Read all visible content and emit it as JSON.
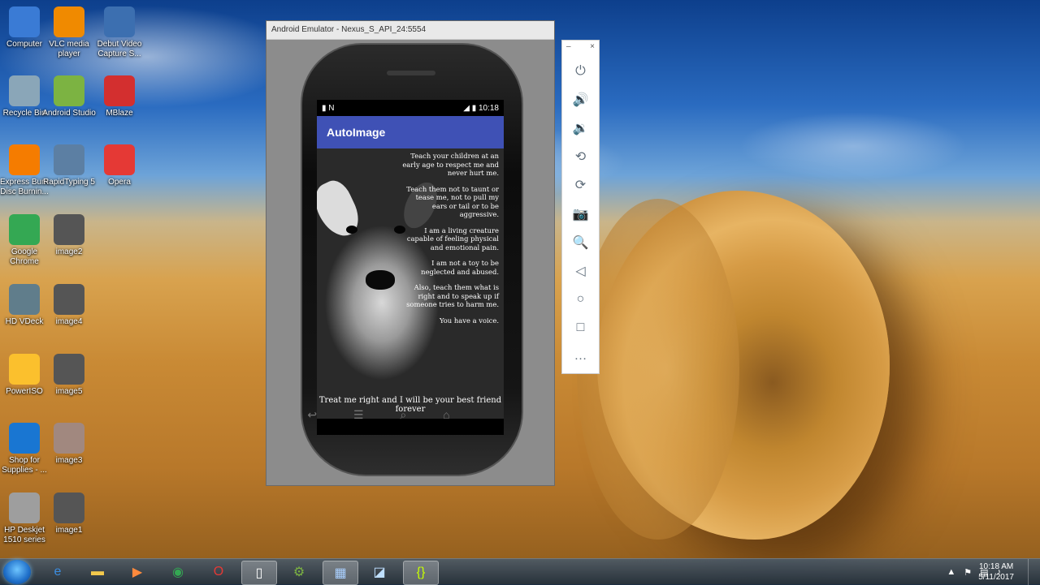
{
  "desktop": {
    "icons": [
      {
        "label": "Computer",
        "icon": "computer-icon",
        "color": "#3a7bd5"
      },
      {
        "label": "VLC media player",
        "icon": "vlc-icon",
        "color": "#f08a00"
      },
      {
        "label": "Debut Video Capture S...",
        "icon": "video-capture-icon",
        "color": "#3c6fb0"
      },
      {
        "label": "Recycle Bin",
        "icon": "recycle-bin-icon",
        "color": "#8aa6b8"
      },
      {
        "label": "Android Studio",
        "icon": "android-studio-icon",
        "color": "#7cb342"
      },
      {
        "label": "MBlaze",
        "icon": "mblaze-icon",
        "color": "#d32f2f"
      },
      {
        "label": "Express Burn Disc Burnin...",
        "icon": "express-burn-icon",
        "color": "#f57c00"
      },
      {
        "label": "RapidTyping 5",
        "icon": "rapidtyping-icon",
        "color": "#5c7fa3"
      },
      {
        "label": "Opera",
        "icon": "opera-icon",
        "color": "#e53935"
      },
      {
        "label": "Google Chrome",
        "icon": "chrome-icon",
        "color": "#34a853"
      },
      {
        "label": "image2",
        "icon": "image-thumbnail-icon",
        "color": "#555555"
      },
      {
        "label": "HD VDeck",
        "icon": "hd-vdeck-icon",
        "color": "#607d8b"
      },
      {
        "label": "image4",
        "icon": "image-thumbnail-icon",
        "color": "#555555"
      },
      {
        "label": "PowerISO",
        "icon": "poweriso-icon",
        "color": "#fbc02d"
      },
      {
        "label": "image5",
        "icon": "image-thumbnail-icon",
        "color": "#555555"
      },
      {
        "label": "Shop for Supplies - ...",
        "icon": "shop-supplies-icon",
        "color": "#1976d2"
      },
      {
        "label": "image3",
        "icon": "image-thumbnail-icon",
        "color": "#a1887f"
      },
      {
        "label": "HP Deskjet 1510 series",
        "icon": "printer-icon",
        "color": "#9e9e9e"
      },
      {
        "label": "image1",
        "icon": "image-thumbnail-icon",
        "color": "#555555"
      }
    ]
  },
  "emulator": {
    "title": "Android Emulator - Nexus_S_API_24:5554",
    "status_time": "10:18",
    "app_title": "AutoImage",
    "poem": [
      "Teach your children at an early age to respect me and never hurt me.",
      "Teach them not to taunt or tease me, not to pull my ears or tail or to be aggressive.",
      "I am a living creature capable of feeling physical and emotional pain.",
      "I am not a toy to be neglected and abused.",
      "Also, teach them what is right and to speak up if someone tries to harm me.",
      "You have a voice."
    ],
    "footer_line": "Treat me right and I will be your best friend forever"
  },
  "toolbar": {
    "minimize": "–",
    "close": "×",
    "buttons": [
      {
        "name": "power-icon",
        "glyph": "⏻"
      },
      {
        "name": "volume-up-icon",
        "glyph": "🔊"
      },
      {
        "name": "volume-down-icon",
        "glyph": "🔉"
      },
      {
        "name": "rotate-left-icon",
        "glyph": "⟲"
      },
      {
        "name": "rotate-right-icon",
        "glyph": "⟳"
      },
      {
        "name": "camera-icon",
        "glyph": "📷"
      },
      {
        "name": "zoom-icon",
        "glyph": "🔍"
      },
      {
        "name": "back-icon",
        "glyph": "◁"
      },
      {
        "name": "home-icon",
        "glyph": "○"
      },
      {
        "name": "overview-icon",
        "glyph": "□"
      },
      {
        "name": "more-icon",
        "glyph": "…"
      }
    ]
  },
  "taskbar": {
    "clock_time": "10:18 AM",
    "clock_date": "5/11/2017"
  }
}
